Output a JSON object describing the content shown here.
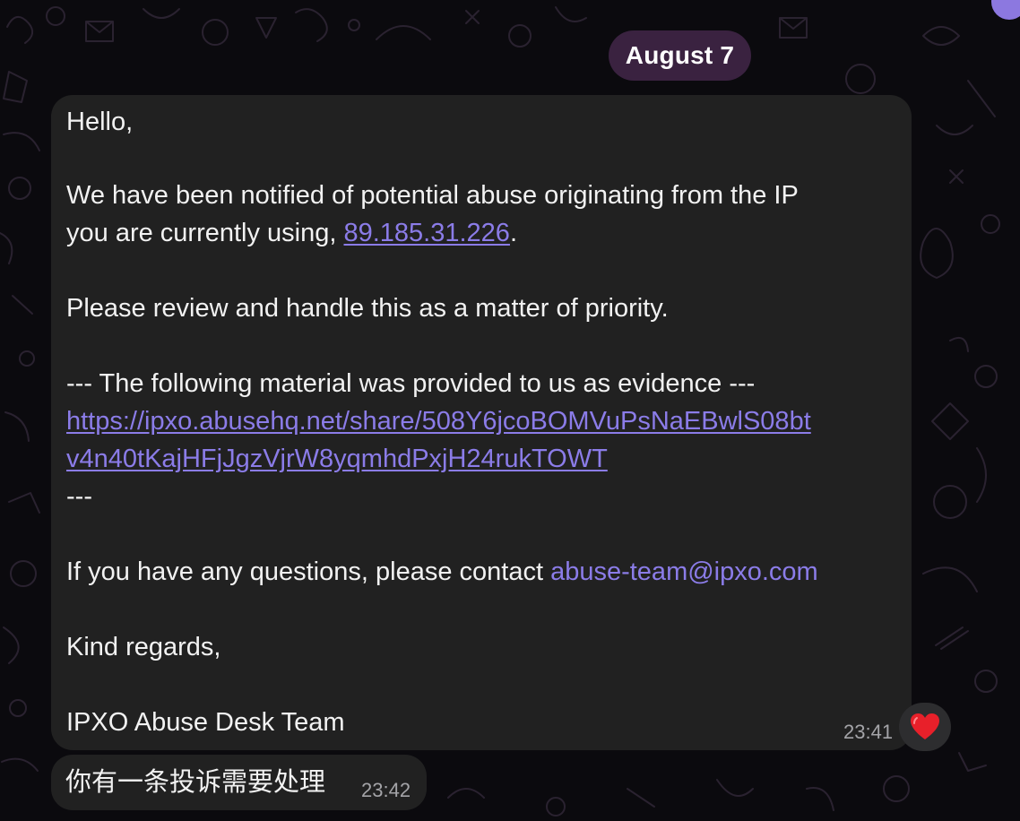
{
  "date_separator": "August 7",
  "message": {
    "greeting": "Hello,",
    "para1_line1": "We have been notified of potential abuse originating from the IP",
    "para1_line2_prefix": "you are currently using, ",
    "ip_link": "89.185.31.226",
    "para1_line2_suffix": ".",
    "para2": "Please review and handle this as a matter of priority.",
    "evidence_header": "--- The following material was provided to us as evidence ---",
    "evidence_link_line1": "https://ipxo.abusehq.net/share/508Y6jcoBOMVuPsNaEBwlS08bt",
    "evidence_link_line2": "v4n40tKajHFjJgzVjrW8yqmhdPxjH24rukTOWT",
    "evidence_footer": "---",
    "contact_prefix": "If you have any questions, please contact ",
    "contact_email": "abuse-team@ipxo.com",
    "closing": "Kind regards,",
    "signature": "IPXO Abuse Desk Team",
    "time": "23:41",
    "reaction_icon": "red-heart-icon"
  },
  "reply": {
    "text": "你有一条投诉需要处理",
    "time": "23:42"
  },
  "colors": {
    "background": "#0b0a0e",
    "bubble": "#212121",
    "link": "#8b7ce8",
    "date_pill": "#3a2240",
    "accent_avatar": "#8c78e0",
    "heart": "#e8202a"
  }
}
